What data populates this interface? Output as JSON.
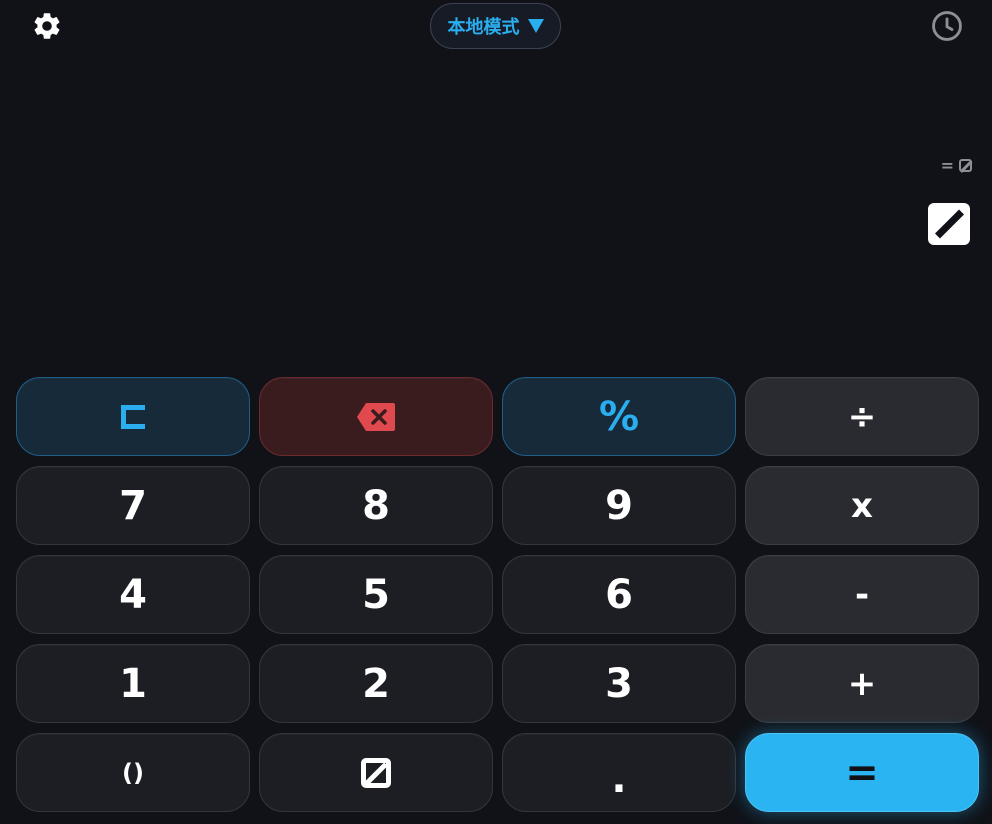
{
  "header": {
    "mode_label": "本地模式",
    "settings_icon": "gear-icon",
    "history_icon": "clock-icon"
  },
  "display": {
    "expression_prefix": "=",
    "expression_value": "0",
    "result": "0"
  },
  "keys": {
    "clear": "C",
    "backspace_icon": "backspace-icon",
    "percent": "%",
    "divide": "÷",
    "seven": "7",
    "eight": "8",
    "nine": "9",
    "multiply": "x",
    "four": "4",
    "five": "5",
    "six": "6",
    "minus": "-",
    "one": "1",
    "two": "2",
    "three": "3",
    "plus": "+",
    "parens": "()",
    "zero": "0",
    "decimal": ".",
    "equals": "="
  },
  "colors": {
    "background": "#101218",
    "accent": "#2aaef0",
    "equals_bg": "#2ab4f2",
    "backspace": "#e04a4f"
  }
}
